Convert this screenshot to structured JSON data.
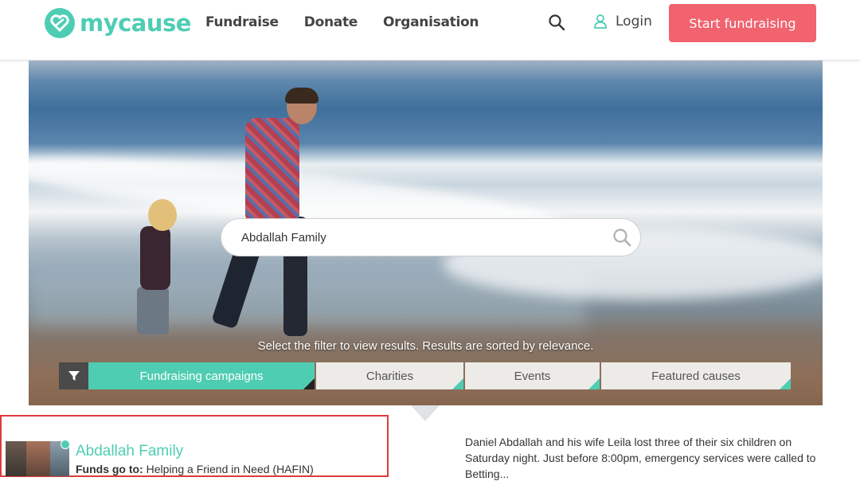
{
  "header": {
    "logo_text": "mycause",
    "nav": [
      "Fundraise",
      "Donate",
      "Organisation"
    ],
    "login_label": "Login",
    "cta_label": "Start fundraising"
  },
  "search": {
    "value": "Abdallah Family"
  },
  "filters": {
    "hint": "Select the filter to view results. Results are sorted by relevance.",
    "tabs": [
      "Fundraising campaigns",
      "Charities",
      "Events",
      "Featured causes"
    ],
    "active_tab": "Fundraising campaigns"
  },
  "result": {
    "title": "Abdallah Family",
    "funds_label": "Funds go to:",
    "funds_value": "Helping a Friend in Need (HAFIN)",
    "description": "Daniel Abdallah and his wife Leila lost three of their six children on Saturday night.  Just before 8:00pm, emergency services were called to Betting..."
  },
  "colors": {
    "accent": "#4fcdb2",
    "cta": "#f0636f",
    "highlight_border": "#e03a3a"
  }
}
